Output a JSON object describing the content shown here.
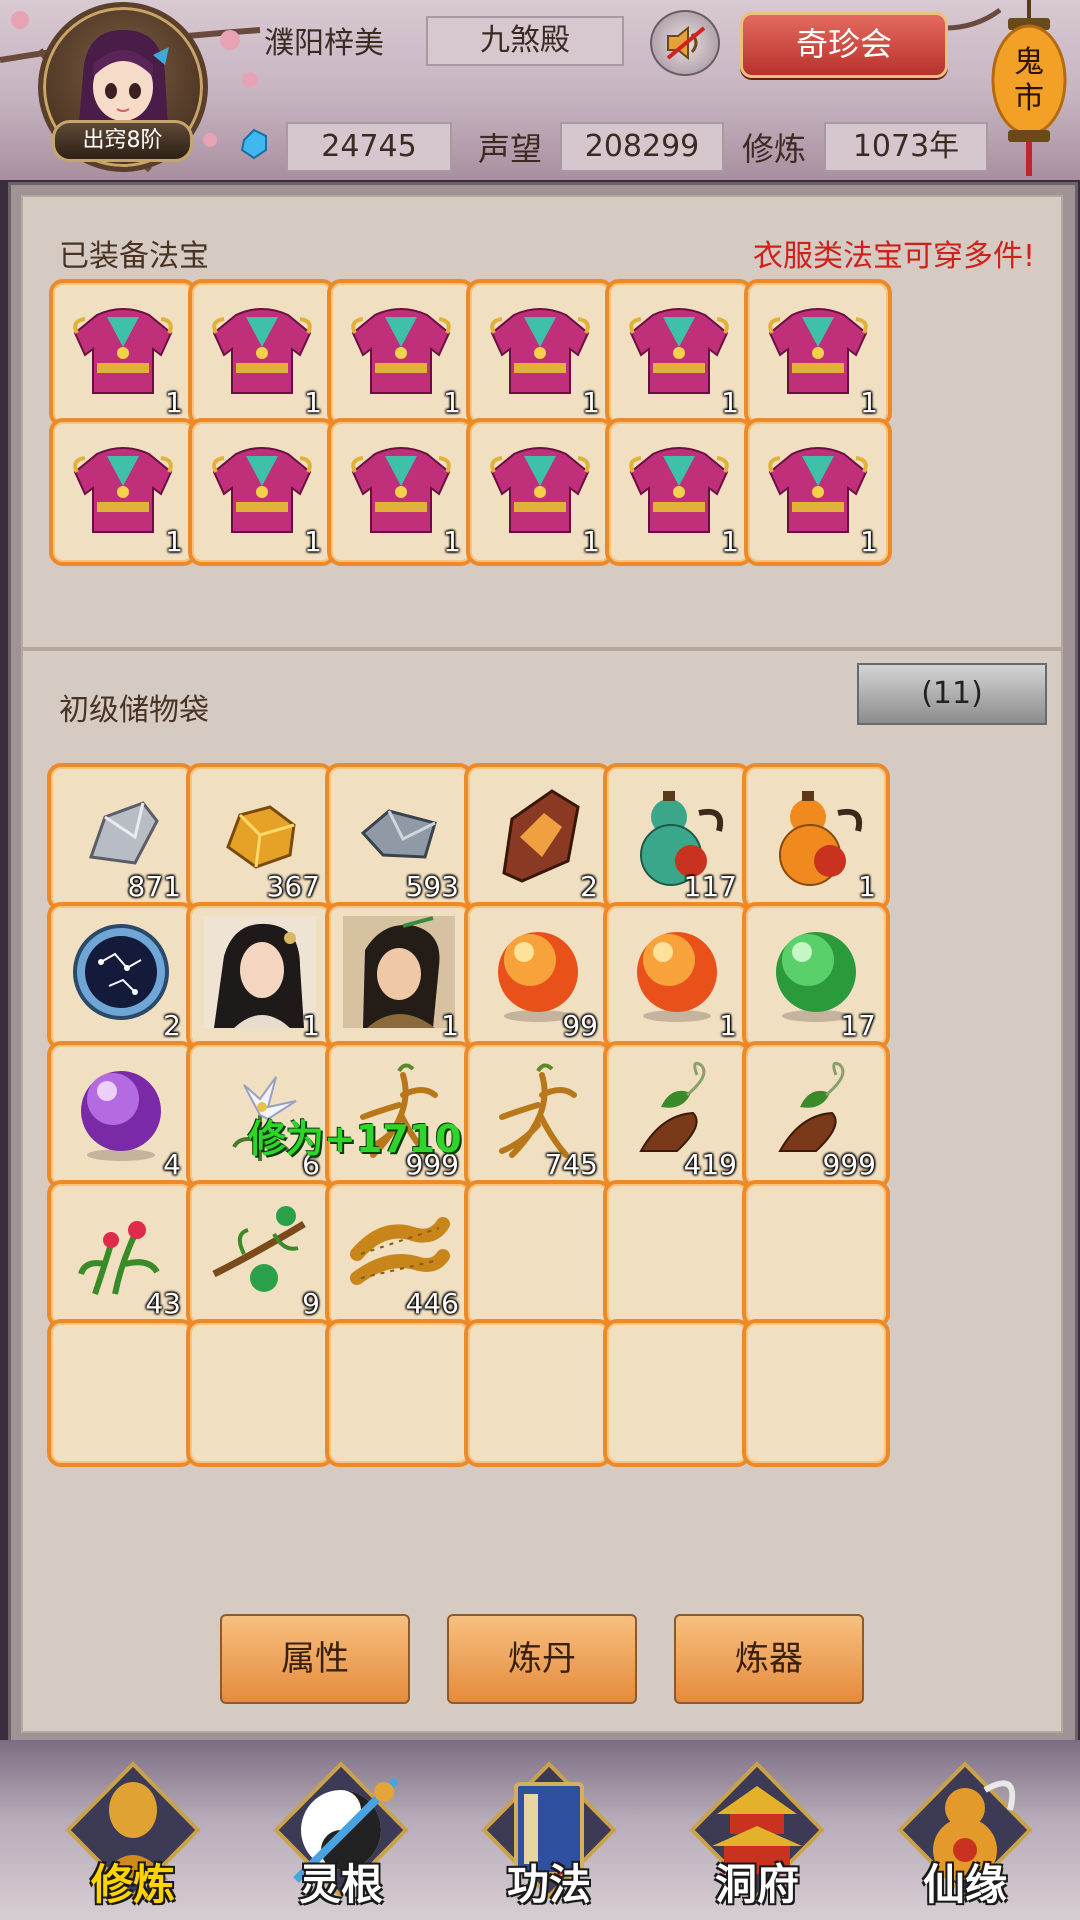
{
  "header": {
    "player_name": "濮阳梓美",
    "title": "九煞殿",
    "realm": "出窍8阶",
    "spirit_stones": "24745",
    "reputation_label": "声望",
    "reputation": "208299",
    "cultivation_label": "修炼",
    "cultivation": "1073年",
    "treasure_button": "奇珍会",
    "lantern_text": "鬼市"
  },
  "equipped": {
    "title": "已装备法宝",
    "hint": "衣服类法宝可穿多件!",
    "slots": [
      {
        "icon": "armor-icon",
        "qty": "1"
      },
      {
        "icon": "armor-icon",
        "qty": "1"
      },
      {
        "icon": "armor-icon",
        "qty": "1"
      },
      {
        "icon": "armor-icon",
        "qty": "1"
      },
      {
        "icon": "armor-icon",
        "qty": "1"
      },
      {
        "icon": "armor-icon",
        "qty": "1"
      },
      {
        "icon": "armor-icon",
        "qty": "1"
      },
      {
        "icon": "armor-icon",
        "qty": "1"
      },
      {
        "icon": "armor-icon",
        "qty": "1"
      },
      {
        "icon": "armor-icon",
        "qty": "1"
      },
      {
        "icon": "armor-icon",
        "qty": "1"
      },
      {
        "icon": "armor-icon",
        "qty": "1"
      }
    ]
  },
  "bag": {
    "title": "初级储物袋",
    "count": "(11)",
    "floating_text": "修为+1710",
    "items": [
      {
        "icon": "silver-ore-icon",
        "qty": "871"
      },
      {
        "icon": "gold-ore-icon",
        "qty": "367"
      },
      {
        "icon": "iron-ore-icon",
        "qty": "593"
      },
      {
        "icon": "crystal-rock-icon",
        "qty": "2"
      },
      {
        "icon": "green-wine-gourd-icon",
        "qty": "117"
      },
      {
        "icon": "orange-wine-gourd-icon",
        "qty": "1"
      },
      {
        "icon": "star-disc-icon",
        "qty": "2"
      },
      {
        "icon": "female-portrait-icon",
        "qty": "1"
      },
      {
        "icon": "male-portrait-icon",
        "qty": "1"
      },
      {
        "icon": "fire-orb-icon",
        "qty": "99"
      },
      {
        "icon": "fire-orb-icon",
        "qty": "1"
      },
      {
        "icon": "green-orb-icon",
        "qty": "17"
      },
      {
        "icon": "purple-orb-icon",
        "qty": "4"
      },
      {
        "icon": "white-flower-icon",
        "qty": "6"
      },
      {
        "icon": "ginseng-icon",
        "qty": "999"
      },
      {
        "icon": "ginseng-icon",
        "qty": "745"
      },
      {
        "icon": "herb-root-icon",
        "qty": "419"
      },
      {
        "icon": "herb-root-icon",
        "qty": "999"
      },
      {
        "icon": "red-flower-herb-icon",
        "qty": "43"
      },
      {
        "icon": "fruit-branch-icon",
        "qty": "9"
      },
      {
        "icon": "cordyceps-icon",
        "qty": "446"
      }
    ],
    "empty_slots": 9
  },
  "actions": {
    "attributes": "属性",
    "alchemy": "炼丹",
    "refining": "炼器"
  },
  "nav": {
    "cultivate": "修炼",
    "spirit_root": "灵根",
    "techniques": "功法",
    "cave": "洞府",
    "destiny": "仙缘"
  },
  "colors": {
    "slot_border": "#ec8a2a",
    "slot_fill": "#f1dfc1",
    "hint_red": "#d0201a",
    "float_green": "#2fd62a",
    "nav_active": "#ffd400"
  }
}
